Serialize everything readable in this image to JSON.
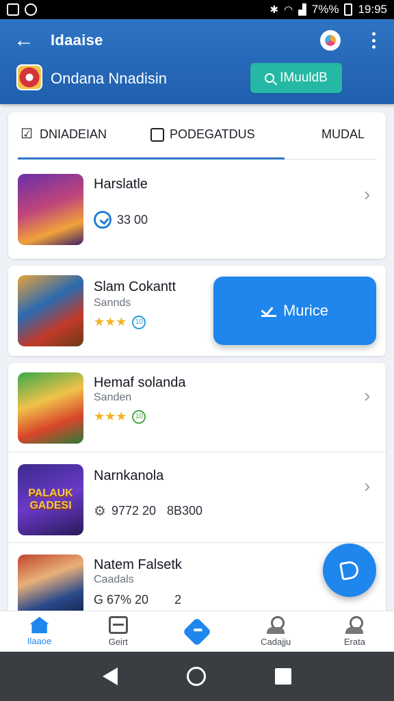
{
  "status_bar": {
    "time": "19:95",
    "battery": "7%%"
  },
  "header": {
    "title": "Idaaise",
    "subtitle": "Ondana Nnadisin",
    "action_label": "IMuuldB"
  },
  "tabs": [
    {
      "label": "DNIADEIAN"
    },
    {
      "label": "PODEGATDUS"
    },
    {
      "label": "MUDAL"
    }
  ],
  "items": [
    {
      "name": "Harslatle",
      "meta": "33 00"
    },
    {
      "name": "Slam Cokantt",
      "sub": "Sannds",
      "stars": "★★★",
      "coin": "10"
    },
    {
      "name": "Hemaf solanda",
      "sub": "Sanden",
      "stars": "★★★",
      "coin": "10"
    },
    {
      "name": "Narnkanola",
      "meta1": "9772 20",
      "meta2": "8B300",
      "thumb_text": "PALAUK GADESI"
    },
    {
      "name": "Natem Falsetk",
      "sub": "Caadals",
      "meta1": "G 67% 20",
      "meta2": "2"
    }
  ],
  "floating_action": {
    "label": "Murice"
  },
  "bottom_nav": [
    {
      "label": "Ilaaoe"
    },
    {
      "label": "Geirt"
    },
    {
      "label": ""
    },
    {
      "label": "Cadajju"
    },
    {
      "label": "Erata"
    }
  ],
  "colors": {
    "header": "#2f74c4",
    "accent": "#1e86ec",
    "teal_button": "#25b8a4"
  }
}
